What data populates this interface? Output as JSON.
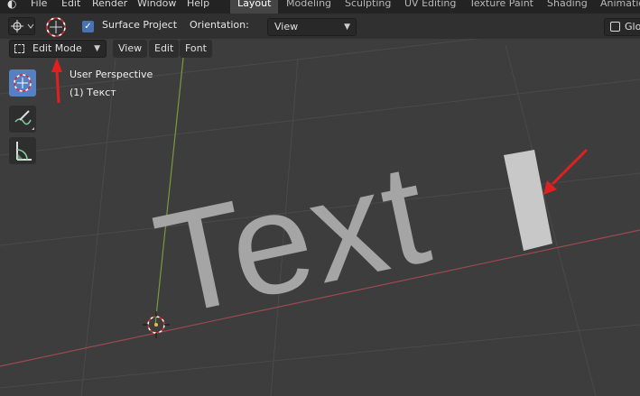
{
  "menubar": {
    "items": [
      "File",
      "Edit",
      "Render",
      "Window",
      "Help"
    ],
    "workspaces": [
      "Layout",
      "Modeling",
      "Sculpting",
      "UV Editing",
      "Texture Paint",
      "Shading",
      "Animatio"
    ],
    "active_workspace": "Layout"
  },
  "tool_header": {
    "surface_project_label": "Surface Project",
    "surface_project_checked": true,
    "orientation_label": "Orientation:",
    "orientation_value": "View",
    "global_label": "Glo"
  },
  "mode_header": {
    "mode_value": "Edit Mode",
    "menus": [
      "View",
      "Edit",
      "Font"
    ]
  },
  "viewport": {
    "perspective_label": "User Perspective",
    "object_label": "(1) Текст",
    "text_object": "Text",
    "colors": {
      "background": "#3d3d3d",
      "grid": "#4a4a4a",
      "x_axis": "#9b4a52",
      "y_axis": "#7a9a3a",
      "text_mesh": "#a5a5a5",
      "text_cursor": "#c8c8c8",
      "arrow": "#e02020",
      "accent": "#5680c2"
    }
  },
  "toolbar": {
    "tools": [
      "cursor-tool-icon",
      "annotate-icon",
      "measure-icon"
    ]
  }
}
